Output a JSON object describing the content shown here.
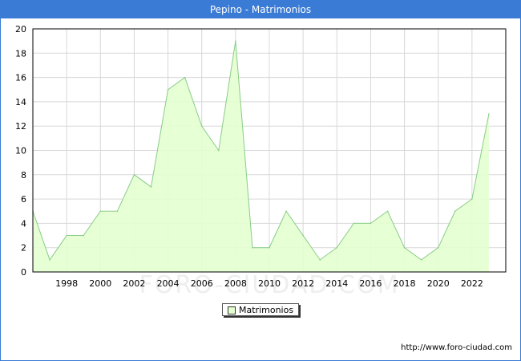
{
  "title": "Pepino - Matrimonios",
  "watermark": "FORO-CIUDAD.COM",
  "footer_url": "http://www.foro-ciudad.com",
  "colors": {
    "header": "#3a7bd5",
    "area_fill": "#e4ffd0",
    "line": "#88cc88",
    "grid": "#d8d8d8"
  },
  "chart_data": {
    "type": "area",
    "x": [
      1996,
      1997,
      1998,
      1999,
      2000,
      2001,
      2002,
      2003,
      2004,
      2005,
      2006,
      2007,
      2008,
      2009,
      2010,
      2011,
      2012,
      2013,
      2014,
      2015,
      2016,
      2017,
      2018,
      2019,
      2020,
      2021,
      2022,
      2023
    ],
    "series": [
      {
        "name": "Matrimonios",
        "values": [
          5,
          1,
          3,
          3,
          5,
          5,
          8,
          7,
          15,
          16,
          12,
          10,
          19,
          2,
          2,
          5,
          3,
          1,
          2,
          4,
          4,
          5,
          2,
          1,
          2,
          5,
          6,
          13
        ]
      }
    ],
    "xticks": [
      "1998",
      "2000",
      "2002",
      "2004",
      "2006",
      "2008",
      "2010",
      "2012",
      "2014",
      "2016",
      "2018",
      "2020",
      "2022"
    ],
    "yticks": [
      "0",
      "2",
      "4",
      "6",
      "8",
      "10",
      "12",
      "14",
      "16",
      "18",
      "20"
    ],
    "xlim": [
      1996,
      2024
    ],
    "ylim": [
      0,
      20
    ],
    "grid": true,
    "legend_position": "bottom-center"
  }
}
